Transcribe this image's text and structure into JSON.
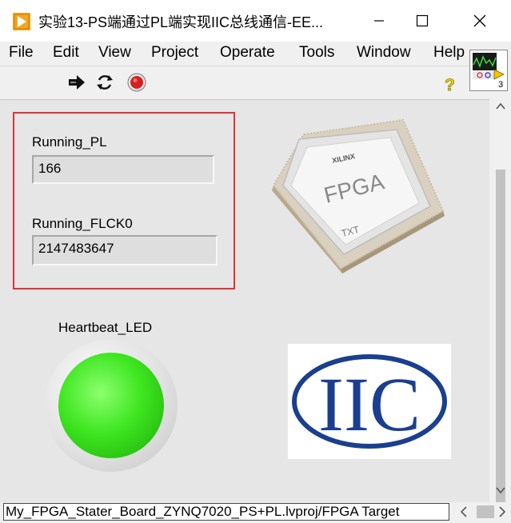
{
  "window": {
    "title": "实验13-PS端通过PL端实现IIC总线通信-EE..."
  },
  "menu": {
    "items": [
      "File",
      "Edit",
      "View",
      "Project",
      "Operate",
      "Tools",
      "Window",
      "Help"
    ]
  },
  "panel": {
    "running_pl": {
      "label": "Running_PL",
      "value": "166"
    },
    "running_flck0": {
      "label": "Running_FLCK0",
      "value": "2147483647"
    },
    "heartbeat": {
      "label": "Heartbeat_LED",
      "state": "on",
      "color": "#3ee620"
    },
    "fpga_chip": {
      "text": "FPGA",
      "brand": "XILINX",
      "mark": "TXT"
    },
    "iic_logo": {
      "text": "IIC",
      "color": "#1b3f8f"
    }
  },
  "vi_icon": {
    "badge": "3"
  },
  "status": {
    "path": "My_FPGA_Stater_Board_ZYNQ7020_PS+PL.lvproj/FPGA Target"
  },
  "colors": {
    "highlight": "#e03434",
    "stop": "#d62020"
  }
}
